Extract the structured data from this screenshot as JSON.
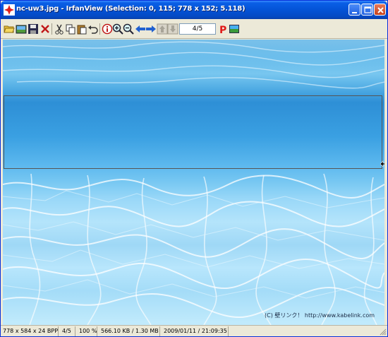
{
  "window": {
    "title": "nc-uw3.jpg - IrfanView (Selection: 0, 115; 778 x 152; 5.118)"
  },
  "title_buttons": {
    "minimize": "minimize-icon",
    "maximize": "maximize-icon",
    "close": "close-icon"
  },
  "toolbar": {
    "icons": [
      "open-folder-icon",
      "thumbnails-icon",
      "save-icon",
      "delete-icon",
      "cut-icon",
      "copy-icon",
      "paste-icon",
      "undo-icon",
      "info-icon",
      "zoom-in-icon",
      "zoom-out-icon",
      "previous-icon",
      "next-icon",
      "first-file-icon",
      "last-file-icon",
      "print-icon",
      "slideshow-icon"
    ],
    "page_value": "4/5"
  },
  "image": {
    "credit": "(C) 壁リンク！  http://www.kabelink.com"
  },
  "statusbar": {
    "dimensions": "778 x 584 x 24 BPP",
    "file_index": "4/5",
    "zoom": "100 %",
    "memory": "566.10 KB / 1.30 MB",
    "datetime": "2009/01/11 / 21:09:35"
  },
  "colors": {
    "titlebar": "#0453d6",
    "close_button": "#c6421b",
    "water_deep": "#2e8fd6",
    "water_light": "#c2ebfc",
    "selection_border": "#555555"
  }
}
